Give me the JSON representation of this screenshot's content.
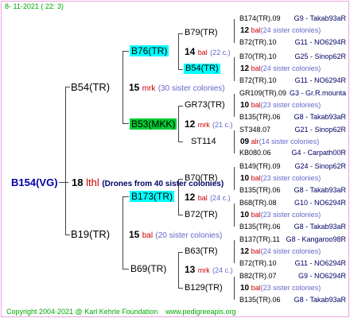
{
  "header": {
    "date": "8- 11-2021 ( 22: 3)"
  },
  "root": {
    "name": "B154(VG)",
    "gen": "18",
    "breed": "lthl",
    "note": "(Drones from 40 sister colonies)"
  },
  "p1": {
    "name": "B54(TR)",
    "gen": "15",
    "breed": "mrk",
    "note": "(30 sister colonies)"
  },
  "p2": {
    "name": "B19(TR)",
    "gen": "15",
    "breed": "bal",
    "note": "(20 sister colonies)"
  },
  "gp": [
    {
      "name": "B76(TR)",
      "gen": "14",
      "breed": "bal",
      "note": "(22 c.)"
    },
    {
      "name": "B53(MKK)",
      "gen": "12",
      "breed": "mrk",
      "note": "(21 c.)"
    },
    {
      "name": "B173(TR)",
      "gen": "12",
      "breed": "bal",
      "note": "(24 c.)"
    },
    {
      "name": "B69(TR)",
      "gen": "13",
      "breed": "mrk",
      "note": "(24 c.)"
    }
  ],
  "ggp": [
    "B79(TR)",
    "B54(TR)",
    "GR73(TR)",
    "ST114",
    "B70(TR)",
    "B72(TR)",
    "B63(TR)",
    "B129(TR)"
  ],
  "g4": [
    {
      "name": "B174(TR).09",
      "ref": "G9 - Takab93aR"
    },
    {
      "gen": "12",
      "breed": "bal",
      "note": "(24 sister colonies)"
    },
    {
      "name": "B72(TR).10",
      "ref": "G11 - NO6294R"
    },
    {
      "name": "B70(TR).10",
      "ref": "G25 - Sinop62R"
    },
    {
      "gen": "12",
      "breed": "bal",
      "note": "(24 sister colonies)"
    },
    {
      "name": "B72(TR).10",
      "ref": "G11 - NO6294R"
    },
    {
      "name": "GR109(TR).09",
      "ref": "G3 - Gr.R.mounta"
    },
    {
      "gen": "10",
      "breed": "bal",
      "note": "(23 sister colonies)"
    },
    {
      "name": "B135(TR).06",
      "ref": "G8 - Takab93aR"
    },
    {
      "name": "ST348.07",
      "ref": "G21 - Sinop62R"
    },
    {
      "gen": "09",
      "breed": "alr",
      "note": "(14 sister colonies)"
    },
    {
      "name": "KB080.06",
      "ref": "G4 - Carpath00R"
    },
    {
      "name": "B149(TR).09",
      "ref": "G24 - Sinop62R"
    },
    {
      "gen": "10",
      "breed": "bal",
      "note": "(23 sister colonies)"
    },
    {
      "name": "B135(TR).06",
      "ref": "G8 - Takab93aR"
    },
    {
      "name": "B68(TR).08",
      "ref": "G10 - NO6294R"
    },
    {
      "gen": "10",
      "breed": "bal",
      "note": "(23 sister colonies)"
    },
    {
      "name": "B135(TR).06",
      "ref": "G8 - Takab93aR"
    },
    {
      "name": "B137(TR).11",
      "ref": "G8 - Kangaroo98R"
    },
    {
      "gen": "12",
      "breed": "bal",
      "note": "(24 sister colonies)"
    },
    {
      "name": "B72(TR).10",
      "ref": "G11 - NO6294R"
    },
    {
      "name": "B82(TR).07",
      "ref": "G9 - NO6294R"
    },
    {
      "gen": "10",
      "breed": "bal",
      "note": "(23 sister colonies)"
    },
    {
      "name": "B135(TR).06",
      "ref": "G8 - Takab93aR"
    }
  ],
  "footer": {
    "copyright": "Copyright 2004-2021 @ Karl Kehrle Foundation",
    "site": "www.pedigreeapis.org"
  }
}
